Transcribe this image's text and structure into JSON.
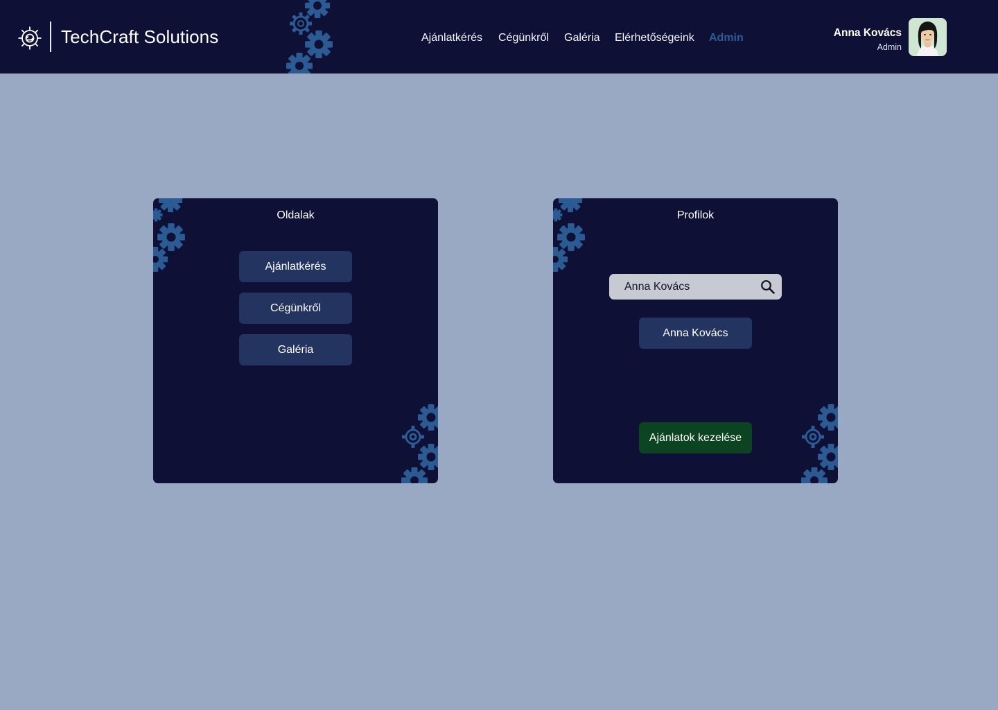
{
  "header": {
    "brand": "TechCraft Solutions",
    "logo_icon": "gear-logo-icon",
    "nav": [
      {
        "label": "Ajánlatkérés",
        "active": false
      },
      {
        "label": "Cégünkről",
        "active": false
      },
      {
        "label": "Galéria",
        "active": false
      },
      {
        "label": "Elérhetőségeink",
        "active": false
      },
      {
        "label": "Admin",
        "active": true
      }
    ],
    "user": {
      "name": "Anna Kovács",
      "role": "Admin"
    }
  },
  "pages_card": {
    "title": "Oldalak",
    "buttons": [
      "Ajánlatkérés",
      "Cégünkről",
      "Galéria"
    ]
  },
  "profiles_card": {
    "title": "Profilok",
    "search_value": "Anna Kovács",
    "search_icon": "magnifier-icon",
    "result": "Anna Kovács",
    "offers_button": "Ajánlatok kezelése"
  },
  "colors": {
    "page_bg": "#99a9c3",
    "header_bg": "#0e1036",
    "card_bg": "#0e1036",
    "button_bg": "#243461",
    "offers_button_bg": "#0c4421",
    "gear_decor": "#2c5a92",
    "nav_active": "#2f5c95"
  }
}
